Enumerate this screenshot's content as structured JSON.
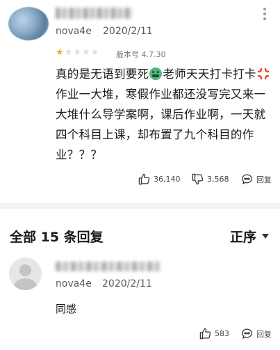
{
  "review": {
    "device": "nova4e",
    "date": "2020/2/11",
    "rating": 1,
    "rating_max": 5,
    "version": "版本号 4.7.30",
    "content_parts": {
      "p1": "真的是无语到要死",
      "p2": "老师天天打卡打卡",
      "p3": "作业一大堆，寒假作业都还没写完又来一大堆什么导学案啊，课后作业啊，一天就四个科目上课，却布置了九个科目的作业？？？"
    },
    "likes": "36,140",
    "dislikes": "3,568",
    "reply_label": "回复"
  },
  "replies_section": {
    "title": "全部 15 条回复",
    "sort_label": "正序"
  },
  "reply": {
    "device": "nova4e",
    "date": "2020/2/11",
    "text": "同感",
    "likes": "583",
    "reply_label": "回复"
  },
  "colors": {
    "star_active": "#f4a82e",
    "star_inactive": "#dcdcdc",
    "divider": "#f3f3f3"
  }
}
